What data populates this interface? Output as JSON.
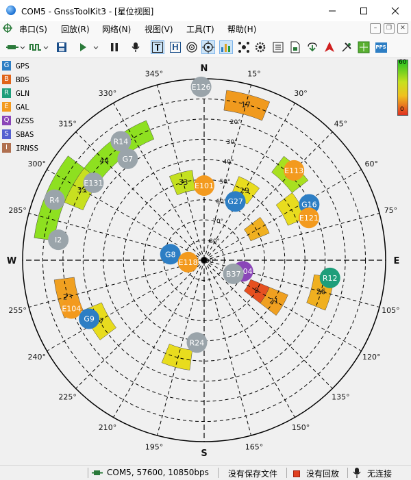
{
  "window": {
    "title": "COM5 - GnssToolKit3 - [星位视图]",
    "min_icon": "minimize-icon",
    "max_icon": "maximize-icon",
    "close_icon": "close-icon"
  },
  "menu": [
    {
      "label": "串口(S)"
    },
    {
      "label": "回放(R)"
    },
    {
      "label": "网络(N)"
    },
    {
      "label": "视图(V)"
    },
    {
      "label": "工具(T)"
    },
    {
      "label": "帮助(H)"
    }
  ],
  "toolbar": {
    "t_label": "T",
    "h_label": "H",
    "pps_label": "PPS"
  },
  "legend": [
    {
      "letter": "G",
      "name": "GPS",
      "color": "#2d7ec4"
    },
    {
      "letter": "B",
      "name": "BDS",
      "color": "#e0641a"
    },
    {
      "letter": "R",
      "name": "GLN",
      "color": "#1e9e7a"
    },
    {
      "letter": "E",
      "name": "GAL",
      "color": "#f39a1e"
    },
    {
      "letter": "Q",
      "name": "QZSS",
      "color": "#8a45b8"
    },
    {
      "letter": "S",
      "name": "SBAS",
      "color": "#5560d0"
    },
    {
      "letter": "I",
      "name": "IRNSS",
      "color": "#b07050"
    }
  ],
  "colorbar": {
    "max": "60",
    "min": "0"
  },
  "sky": {
    "cardinals": {
      "N": "N",
      "E": "E",
      "S": "S",
      "W": "W"
    },
    "azimuth_labels": [
      {
        "az": 15,
        "text": "15°"
      },
      {
        "az": 30,
        "text": "30°"
      },
      {
        "az": 45,
        "text": "45°"
      },
      {
        "az": 60,
        "text": "60°"
      },
      {
        "az": 75,
        "text": "75°"
      },
      {
        "az": 105,
        "text": "105°"
      },
      {
        "az": 120,
        "text": "120°"
      },
      {
        "az": 135,
        "text": "135°"
      },
      {
        "az": 150,
        "text": "150°"
      },
      {
        "az": 165,
        "text": "165°"
      },
      {
        "az": 195,
        "text": "195°"
      },
      {
        "az": 210,
        "text": "210°"
      },
      {
        "az": 225,
        "text": "225°"
      },
      {
        "az": 240,
        "text": "240°"
      },
      {
        "az": 255,
        "text": "255°"
      },
      {
        "az": 285,
        "text": "285°"
      },
      {
        "az": 300,
        "text": "300°"
      },
      {
        "az": 315,
        "text": "315°"
      },
      {
        "az": 330,
        "text": "330°"
      },
      {
        "az": 345,
        "text": "345°"
      }
    ],
    "elevation_labels": [
      {
        "el": 20,
        "text": "20°"
      },
      {
        "el": 30,
        "text": "30°"
      },
      {
        "el": 40,
        "text": "40°"
      },
      {
        "el": 50,
        "text": "50°"
      },
      {
        "el": 60,
        "text": "60°"
      },
      {
        "el": 70,
        "text": "70°"
      },
      {
        "el": 80,
        "text": "80°"
      },
      {
        "el": 90,
        "text": "90°"
      }
    ],
    "cells": [
      {
        "az": 15,
        "el": 10,
        "snr": "17",
        "color": "#f09a1e"
      },
      {
        "az": 30,
        "el": 50,
        "snr": "29",
        "color": "#e8dc1e"
      },
      {
        "az": 345,
        "el": 50,
        "snr": "33",
        "color": "#c4e020"
      },
      {
        "az": 45,
        "el": 30,
        "snr": "37",
        "color": "#a8e020"
      },
      {
        "az": 60,
        "el": 40,
        "snr": "",
        "color": "#e8dc1e"
      },
      {
        "az": 60,
        "el": 60,
        "snr": "",
        "color": "#f0b020"
      },
      {
        "az": 105,
        "el": 30,
        "snr": "26",
        "color": "#f0b020"
      },
      {
        "az": 120,
        "el": 50,
        "snr": "21",
        "color": "#f0a020"
      },
      {
        "az": 120,
        "el": 60,
        "snr": "9",
        "color": "#e65020"
      },
      {
        "az": 195,
        "el": 40,
        "snr": "",
        "color": "#e8dc1e"
      },
      {
        "az": 240,
        "el": 30,
        "snr": "27",
        "color": "#e8dc1e"
      },
      {
        "az": 255,
        "el": 20,
        "snr": "23",
        "color": "#f0a020"
      },
      {
        "az": 285,
        "el": 10,
        "snr": "",
        "color": "#8ee020"
      },
      {
        "az": 300,
        "el": 10,
        "snr": "",
        "color": "#8ee020"
      },
      {
        "az": 300,
        "el": 20,
        "snr": "33",
        "color": "#c8e020"
      },
      {
        "az": 315,
        "el": 20,
        "snr": "44",
        "color": "#8ee020"
      },
      {
        "az": 330,
        "el": 20,
        "snr": "",
        "color": "#8ee020"
      }
    ],
    "satellites": [
      {
        "id": "E126",
        "az": 359,
        "el": 4,
        "color": "#9aa4aa"
      },
      {
        "id": "R14",
        "az": 325,
        "el": 18,
        "color": "#9aa4aa"
      },
      {
        "id": "G7",
        "az": 323,
        "el": 27,
        "color": "#9aa4aa"
      },
      {
        "id": "E131",
        "az": 305,
        "el": 23,
        "color": "#9aa4aa"
      },
      {
        "id": "R4",
        "az": 292,
        "el": 10,
        "color": "#9aa4aa"
      },
      {
        "id": "I2",
        "az": 278,
        "el": 17,
        "color": "#9aa4aa"
      },
      {
        "id": "E101",
        "az": 0,
        "el": 53,
        "color": "#f39a1e"
      },
      {
        "id": "G27",
        "az": 28,
        "el": 57,
        "color": "#2d7ec4"
      },
      {
        "id": "E113",
        "az": 45,
        "el": 27,
        "color": "#f39a1e"
      },
      {
        "id": "G16",
        "az": 62,
        "el": 31,
        "color": "#2d7ec4"
      },
      {
        "id": "E121",
        "az": 68,
        "el": 34,
        "color": "#f39a1e"
      },
      {
        "id": "E104",
        "az": 106,
        "el": 70,
        "color": "#8a45b8"
      },
      {
        "id": "B37",
        "az": 115,
        "el": 74,
        "color": "#9aa4aa"
      },
      {
        "id": "R12",
        "az": 98,
        "el": 27,
        "color": "#1e9e7a"
      },
      {
        "id": "G8",
        "az": 280,
        "el": 73,
        "color": "#2d7ec4"
      },
      {
        "id": "E118",
        "az": 263,
        "el": 82,
        "color": "#f39a1e"
      },
      {
        "id": "E104",
        "az": 250,
        "el": 20,
        "color": "#f39a1e"
      },
      {
        "id": "G9",
        "az": 243,
        "el": 26,
        "color": "#2d7ec4"
      },
      {
        "id": "R24",
        "az": 185,
        "el": 49,
        "color": "#9aa4aa"
      }
    ]
  },
  "status": {
    "port": "COM5, 57600, 10850bps",
    "save": "没有保存文件",
    "replay": "没有回放",
    "connection": "无连接"
  }
}
